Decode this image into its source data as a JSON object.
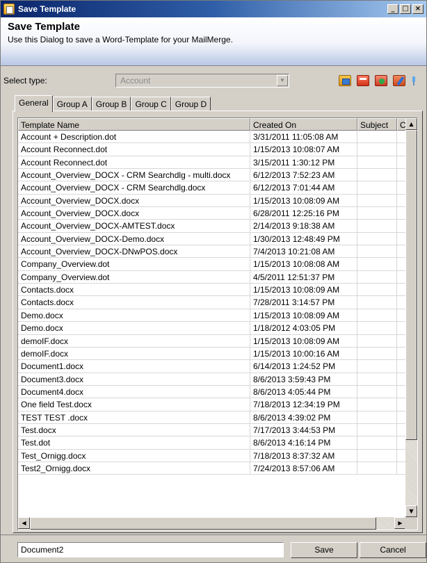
{
  "window": {
    "title": "Save Template",
    "controls": [
      "_",
      "□",
      "×"
    ]
  },
  "header": {
    "title": "Save Template",
    "subtitle": "Use this Dialog to save a Word-Template for your MailMerge."
  },
  "select_type": {
    "label": "Select type:",
    "value": "Account"
  },
  "toolbar_icons": [
    "folder-open-icon",
    "folder-red-icon",
    "folder-add-icon",
    "folder-edit-icon",
    "pin-icon"
  ],
  "tabs": [
    {
      "label": "General",
      "active": true
    },
    {
      "label": "Group A"
    },
    {
      "label": "Group B"
    },
    {
      "label": "Group C"
    },
    {
      "label": "Group D"
    }
  ],
  "grid": {
    "columns": [
      "Template Name",
      "Created On",
      "Subject",
      "C"
    ],
    "rows": [
      [
        "Account + Description.dot",
        "3/31/2011 11:05:08 AM"
      ],
      [
        "Account Reconnect.dot",
        "1/15/2013 10:08:07 AM"
      ],
      [
        "Account Reconnect.dot",
        "3/15/2011 1:30:12 PM"
      ],
      [
        "Account_Overview_DOCX - CRM Searchdlg - multi.docx",
        "6/12/2013 7:52:23 AM"
      ],
      [
        "Account_Overview_DOCX - CRM Searchdlg.docx",
        "6/12/2013 7:01:44 AM"
      ],
      [
        "Account_Overview_DOCX.docx",
        "1/15/2013 10:08:09 AM"
      ],
      [
        "Account_Overview_DOCX.docx",
        "6/28/2011 12:25:16 PM"
      ],
      [
        "Account_Overview_DOCX-AMTEST.docx",
        "2/14/2013 9:18:38 AM"
      ],
      [
        "Account_Overview_DOCX-Demo.docx",
        "1/30/2013 12:48:49 PM"
      ],
      [
        "Account_Overview_DOCX-DNwPOS.docx",
        "7/4/2013 10:21:08 AM"
      ],
      [
        "Company_Overview.dot",
        "1/15/2013 10:08:08 AM"
      ],
      [
        "Company_Overview.dot",
        "4/5/2011 12:51:37 PM"
      ],
      [
        "Contacts.docx",
        "1/15/2013 10:08:09 AM"
      ],
      [
        "Contacts.docx",
        "7/28/2011 3:14:57 PM"
      ],
      [
        "Demo.docx",
        "1/15/2013 10:08:09 AM"
      ],
      [
        "Demo.docx",
        "1/18/2012 4:03:05 PM"
      ],
      [
        "demoIF.docx",
        "1/15/2013 10:08:09 AM"
      ],
      [
        "demoIF.docx",
        "1/15/2013 10:00:16 AM"
      ],
      [
        "Document1.docx",
        "6/14/2013 1:24:52 PM"
      ],
      [
        "Document3.docx",
        "8/6/2013 3:59:43 PM"
      ],
      [
        "Document4.docx",
        "8/6/2013 4:05:44 PM"
      ],
      [
        "One field Test.docx",
        "7/18/2013 12:34:19 PM"
      ],
      [
        "TEST TEST .docx",
        "8/6/2013 4:39:02 PM"
      ],
      [
        "Test.docx",
        "7/17/2013 3:44:53 PM"
      ],
      [
        "Test.dot",
        "8/6/2013 4:16:14 PM"
      ],
      [
        "Test_Ornigg.docx",
        "7/18/2013 8:37:32 AM"
      ],
      [
        "Test2_Ornigg.docx",
        "7/24/2013 8:57:06 AM"
      ]
    ]
  },
  "footer": {
    "filename_value": "Document2",
    "save_label": "Save",
    "cancel_label": "Cancel"
  }
}
